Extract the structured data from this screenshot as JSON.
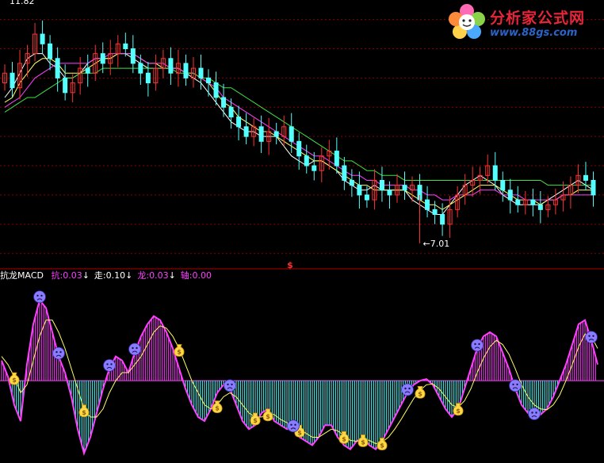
{
  "logo": {
    "title": "分析家公式网",
    "url": "www.88gs.com"
  },
  "price_label_top": "11.82",
  "price_label_low": "7.01",
  "divider_marker": "$",
  "indicator": {
    "name": "抗龙MACD",
    "items": [
      {
        "label": "抗:",
        "value": "0.03",
        "arrow": "↓",
        "color": "#ff40ff"
      },
      {
        "label": "走:",
        "value": "0.10",
        "arrow": "↓",
        "color": "#ffffff"
      },
      {
        "label": "龙:",
        "value": "0.03",
        "arrow": "↓",
        "color": "#ff40ff"
      },
      {
        "label": "轴:",
        "value": "0.00",
        "arrow": "",
        "color": "#ff40ff"
      }
    ]
  },
  "colors": {
    "up_candle": "#ff3232",
    "down_candle": "#54ffff",
    "ma_short": "#ffffff",
    "ma_mid": "#ffff66",
    "ma_long": "#ff40ff",
    "ma_longest": "#40e040",
    "grid": "#8b0000",
    "macd_line": "#ff40ff",
    "signal_line": "#ffff66",
    "hist_pos": "#ff40ff",
    "hist_neg": "#54ffff"
  },
  "icons": {
    "buy": "money-bag-icon",
    "sell": "sad-face-icon"
  },
  "chart_data": [
    {
      "type": "candlestick",
      "title": "",
      "ylim": [
        6.6,
        12.0
      ],
      "gridlines": [
        11.6,
        11.0,
        10.4,
        9.8,
        9.2,
        8.6,
        8.0,
        7.4,
        6.8
      ],
      "grid": true,
      "closes": [
        10.5,
        10.2,
        10.7,
        10.9,
        11.3,
        11.1,
        10.8,
        10.4,
        10.1,
        10.3,
        10.6,
        10.5,
        10.9,
        10.7,
        10.9,
        11.1,
        11.0,
        10.7,
        10.5,
        10.3,
        10.6,
        10.8,
        10.5,
        10.7,
        10.4,
        10.6,
        10.4,
        10.3,
        10.0,
        9.8,
        9.6,
        9.4,
        9.2,
        9.4,
        9.1,
        9.3,
        9.2,
        9.4,
        9.1,
        8.8,
        8.6,
        8.5,
        8.8,
        8.9,
        8.6,
        8.3,
        8.2,
        8.0,
        7.9,
        8.3,
        8.1,
        8.0,
        8.2,
        8.1,
        8.2,
        7.9,
        7.7,
        7.6,
        7.4,
        7.7,
        8.0,
        8.2,
        8.3,
        8.4,
        8.6,
        8.3,
        8.1,
        7.9,
        7.8,
        7.9,
        7.8,
        7.7,
        7.8,
        7.9,
        8.0,
        8.2,
        8.4,
        8.3,
        8.0
      ],
      "low_label": {
        "value": 7.01,
        "index": 55
      },
      "series": [
        {
          "values": [
            10.0,
            10.2,
            10.5,
            10.8,
            10.9,
            10.9,
            10.7,
            10.6,
            10.4,
            10.4,
            10.5,
            10.7,
            10.8,
            10.8,
            10.8,
            10.9,
            10.9,
            10.8,
            10.7,
            10.6,
            10.6,
            10.6,
            10.6,
            10.6,
            10.5,
            10.4,
            10.3,
            10.1,
            9.9,
            9.7,
            9.5,
            9.4,
            9.3,
            9.3,
            9.2,
            9.2,
            9.2,
            9.0,
            8.8,
            8.7,
            8.6,
            8.7,
            8.7,
            8.6,
            8.5,
            8.3,
            8.2,
            8.1,
            8.1,
            8.2,
            8.1,
            8.1,
            8.1,
            8.1,
            7.9,
            7.8,
            7.7,
            7.6,
            7.6,
            7.8,
            8.0,
            8.2,
            8.3,
            8.4,
            8.3,
            8.2,
            8.0,
            7.9,
            7.8,
            7.8,
            7.8,
            7.8,
            7.9,
            8.0,
            8.1,
            8.2,
            8.3,
            8.2,
            8.1
          ]
        },
        {
          "values": [
            9.9,
            10.0,
            10.3,
            10.5,
            10.7,
            10.8,
            10.8,
            10.7,
            10.5,
            10.5,
            10.5,
            10.6,
            10.7,
            10.8,
            10.8,
            10.9,
            10.9,
            10.9,
            10.8,
            10.7,
            10.7,
            10.6,
            10.6,
            10.6,
            10.5,
            10.5,
            10.4,
            10.3,
            10.1,
            9.9,
            9.8,
            9.6,
            9.5,
            9.4,
            9.3,
            9.3,
            9.2,
            9.1,
            9.0,
            8.9,
            8.8,
            8.7,
            8.7,
            8.6,
            8.5,
            8.4,
            8.3,
            8.2,
            8.2,
            8.1,
            8.1,
            8.1,
            8.1,
            8.1,
            8.0,
            7.9,
            7.8,
            7.8,
            7.7,
            7.8,
            7.9,
            8.0,
            8.1,
            8.2,
            8.2,
            8.2,
            8.1,
            8.0,
            7.9,
            7.9,
            7.9,
            7.8,
            7.9,
            7.9,
            8.0,
            8.0,
            8.1,
            8.1,
            8.1
          ]
        },
        {
          "values": [
            9.8,
            9.9,
            10.0,
            10.2,
            10.4,
            10.5,
            10.6,
            10.7,
            10.7,
            10.7,
            10.7,
            10.7,
            10.8,
            10.8,
            10.9,
            10.9,
            10.9,
            10.9,
            10.8,
            10.7,
            10.7,
            10.7,
            10.6,
            10.6,
            10.5,
            10.5,
            10.4,
            10.3,
            10.2,
            10.0,
            9.9,
            9.8,
            9.7,
            9.6,
            9.5,
            9.4,
            9.3,
            9.2,
            9.1,
            9.0,
            8.9,
            8.8,
            8.8,
            8.7,
            8.6,
            8.5,
            8.4,
            8.4,
            8.3,
            8.3,
            8.2,
            8.2,
            8.2,
            8.2,
            8.1,
            8.1,
            8.0,
            8.0,
            7.9,
            7.9,
            8.0,
            8.0,
            8.0,
            8.1,
            8.1,
            8.1,
            8.0,
            8.0,
            8.0,
            7.9,
            7.9,
            7.9,
            7.9,
            7.9,
            8.0,
            8.0,
            8.0,
            8.0,
            8.0
          ]
        },
        {
          "values": [
            9.7,
            9.8,
            9.9,
            10.0,
            10.0,
            10.1,
            10.2,
            10.3,
            10.4,
            10.4,
            10.5,
            10.5,
            10.5,
            10.6,
            10.6,
            10.6,
            10.6,
            10.6,
            10.6,
            10.6,
            10.6,
            10.6,
            10.6,
            10.5,
            10.5,
            10.5,
            10.4,
            10.4,
            10.3,
            10.2,
            10.2,
            10.1,
            10.0,
            9.9,
            9.8,
            9.7,
            9.6,
            9.5,
            9.4,
            9.3,
            9.2,
            9.1,
            9.0,
            8.9,
            8.8,
            8.7,
            8.7,
            8.6,
            8.5,
            8.5,
            8.4,
            8.4,
            8.4,
            8.3,
            8.3,
            8.3,
            8.3,
            8.3,
            8.3,
            8.3,
            8.3,
            8.3,
            8.3,
            8.3,
            8.3,
            8.3,
            8.3,
            8.3,
            8.3,
            8.3,
            8.3,
            8.3,
            8.2,
            8.2,
            8.2,
            8.2,
            8.2,
            8.2,
            8.2
          ]
        }
      ]
    },
    {
      "type": "line",
      "title": "抗龙MACD",
      "ylim": [
        -1.0,
        1.2
      ],
      "histogram": [
        0.25,
        0.05,
        -0.3,
        -0.5,
        0.2,
        0.7,
        1.0,
        0.9,
        0.6,
        0.3,
        0.1,
        -0.2,
        -0.6,
        -0.9,
        -0.7,
        -0.4,
        -0.1,
        0.15,
        0.3,
        0.25,
        0.1,
        0.35,
        0.55,
        0.7,
        0.8,
        0.75,
        0.6,
        0.4,
        0.15,
        -0.1,
        -0.3,
        -0.45,
        -0.5,
        -0.35,
        -0.15,
        -0.05,
        -0.1,
        -0.3,
        -0.5,
        -0.6,
        -0.55,
        -0.4,
        -0.35,
        -0.5,
        -0.55,
        -0.6,
        -0.6,
        -0.7,
        -0.75,
        -0.8,
        -0.7,
        -0.55,
        -0.55,
        -0.7,
        -0.8,
        -0.85,
        -0.75,
        -0.7,
        -0.8,
        -0.85,
        -0.75,
        -0.6,
        -0.45,
        -0.3,
        -0.15,
        -0.05,
        0.0,
        0.02,
        -0.05,
        -0.2,
        -0.35,
        -0.45,
        -0.35,
        -0.1,
        0.15,
        0.4,
        0.55,
        0.6,
        0.55,
        0.35,
        0.15,
        -0.1,
        -0.3,
        -0.4,
        -0.45,
        -0.42,
        -0.35,
        -0.2,
        0.0,
        0.2,
        0.45,
        0.7,
        0.75,
        0.5,
        0.2
      ],
      "series": [
        {
          "values": [
            0.25,
            0.05,
            -0.3,
            -0.5,
            0.2,
            0.7,
            1.0,
            0.9,
            0.6,
            0.3,
            0.1,
            -0.2,
            -0.6,
            -0.9,
            -0.7,
            -0.4,
            -0.1,
            0.15,
            0.3,
            0.25,
            0.1,
            0.35,
            0.55,
            0.7,
            0.8,
            0.75,
            0.6,
            0.4,
            0.15,
            -0.1,
            -0.3,
            -0.45,
            -0.5,
            -0.35,
            -0.15,
            -0.05,
            -0.1,
            -0.3,
            -0.5,
            -0.6,
            -0.55,
            -0.4,
            -0.35,
            -0.5,
            -0.55,
            -0.6,
            -0.6,
            -0.7,
            -0.75,
            -0.8,
            -0.7,
            -0.55,
            -0.55,
            -0.7,
            -0.8,
            -0.85,
            -0.75,
            -0.7,
            -0.8,
            -0.85,
            -0.75,
            -0.6,
            -0.45,
            -0.3,
            -0.15,
            -0.05,
            0.0,
            0.02,
            -0.05,
            -0.2,
            -0.35,
            -0.45,
            -0.35,
            -0.1,
            0.15,
            0.4,
            0.55,
            0.6,
            0.55,
            0.35,
            0.15,
            -0.1,
            -0.3,
            -0.4,
            -0.45,
            -0.42,
            -0.35,
            -0.2,
            0.0,
            0.2,
            0.45,
            0.7,
            0.75,
            0.5,
            0.2
          ]
        },
        {
          "values": [
            0.3,
            0.2,
            0.05,
            -0.15,
            -0.05,
            0.25,
            0.55,
            0.75,
            0.75,
            0.6,
            0.4,
            0.15,
            -0.1,
            -0.35,
            -0.45,
            -0.45,
            -0.35,
            -0.15,
            0.0,
            0.1,
            0.1,
            0.2,
            0.3,
            0.45,
            0.6,
            0.68,
            0.65,
            0.55,
            0.4,
            0.2,
            0.0,
            -0.15,
            -0.3,
            -0.35,
            -0.3,
            -0.2,
            -0.15,
            -0.2,
            -0.3,
            -0.4,
            -0.45,
            -0.45,
            -0.4,
            -0.42,
            -0.48,
            -0.52,
            -0.55,
            -0.6,
            -0.65,
            -0.7,
            -0.7,
            -0.65,
            -0.6,
            -0.62,
            -0.68,
            -0.74,
            -0.75,
            -0.72,
            -0.74,
            -0.78,
            -0.76,
            -0.7,
            -0.6,
            -0.48,
            -0.35,
            -0.22,
            -0.12,
            -0.05,
            -0.04,
            -0.1,
            -0.2,
            -0.3,
            -0.33,
            -0.25,
            -0.1,
            0.1,
            0.28,
            0.42,
            0.5,
            0.45,
            0.33,
            0.15,
            -0.05,
            -0.2,
            -0.3,
            -0.35,
            -0.36,
            -0.3,
            -0.18,
            0.0,
            0.2,
            0.42,
            0.58,
            0.55,
            0.4
          ]
        }
      ],
      "buy_marks": [
        2,
        13,
        28,
        34,
        40,
        42,
        47,
        54,
        57,
        60,
        66,
        72
      ],
      "sell_marks": [
        6,
        9,
        17,
        21,
        36,
        46,
        64,
        75,
        81,
        84,
        93
      ]
    }
  ]
}
